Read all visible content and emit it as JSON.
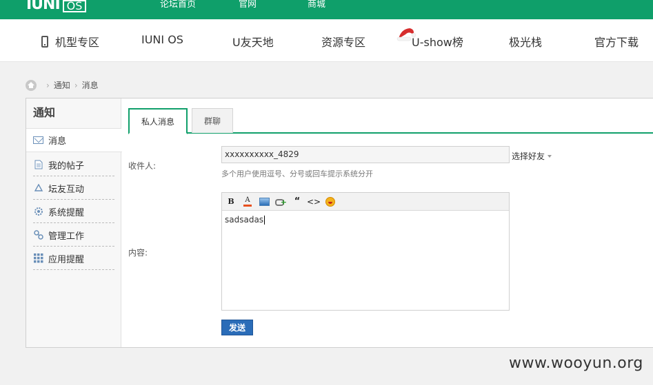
{
  "header": {
    "logo_text": "IUNI",
    "logo_box_text": "OS",
    "links": [
      "论坛首页",
      "官网",
      "商城"
    ]
  },
  "nav": {
    "items": [
      "机型专区",
      "IUNI OS",
      "U友天地",
      "资源专区",
      "U-show榜",
      "极光栈",
      "官方下载"
    ]
  },
  "breadcrumb": [
    "通知",
    "消息"
  ],
  "sidebar": {
    "title": "通知",
    "items": [
      {
        "label": "消息",
        "icon": "envelope-icon"
      },
      {
        "label": "我的帖子",
        "icon": "document-icon"
      },
      {
        "label": "坛友互动",
        "icon": "recycle-icon"
      },
      {
        "label": "系统提醒",
        "icon": "gear-icon"
      },
      {
        "label": "管理工作",
        "icon": "link-icon"
      },
      {
        "label": "应用提醒",
        "icon": "grid-icon"
      }
    ]
  },
  "tabs": [
    "私人消息",
    "群聊"
  ],
  "form": {
    "recipient_label": "收件人:",
    "recipient_value": "xxxxxxxxxx_4829",
    "pick_friend": "选择好友",
    "hint": "多个用户使用逗号、分号或回车提示系统分开",
    "content_label": "内容:",
    "content_value": "sadsadas",
    "send_label": "发送"
  },
  "watermark": "www.wooyun.org",
  "colors": {
    "brand_green": "#0f9f6a",
    "send_blue": "#2a6cb8"
  }
}
